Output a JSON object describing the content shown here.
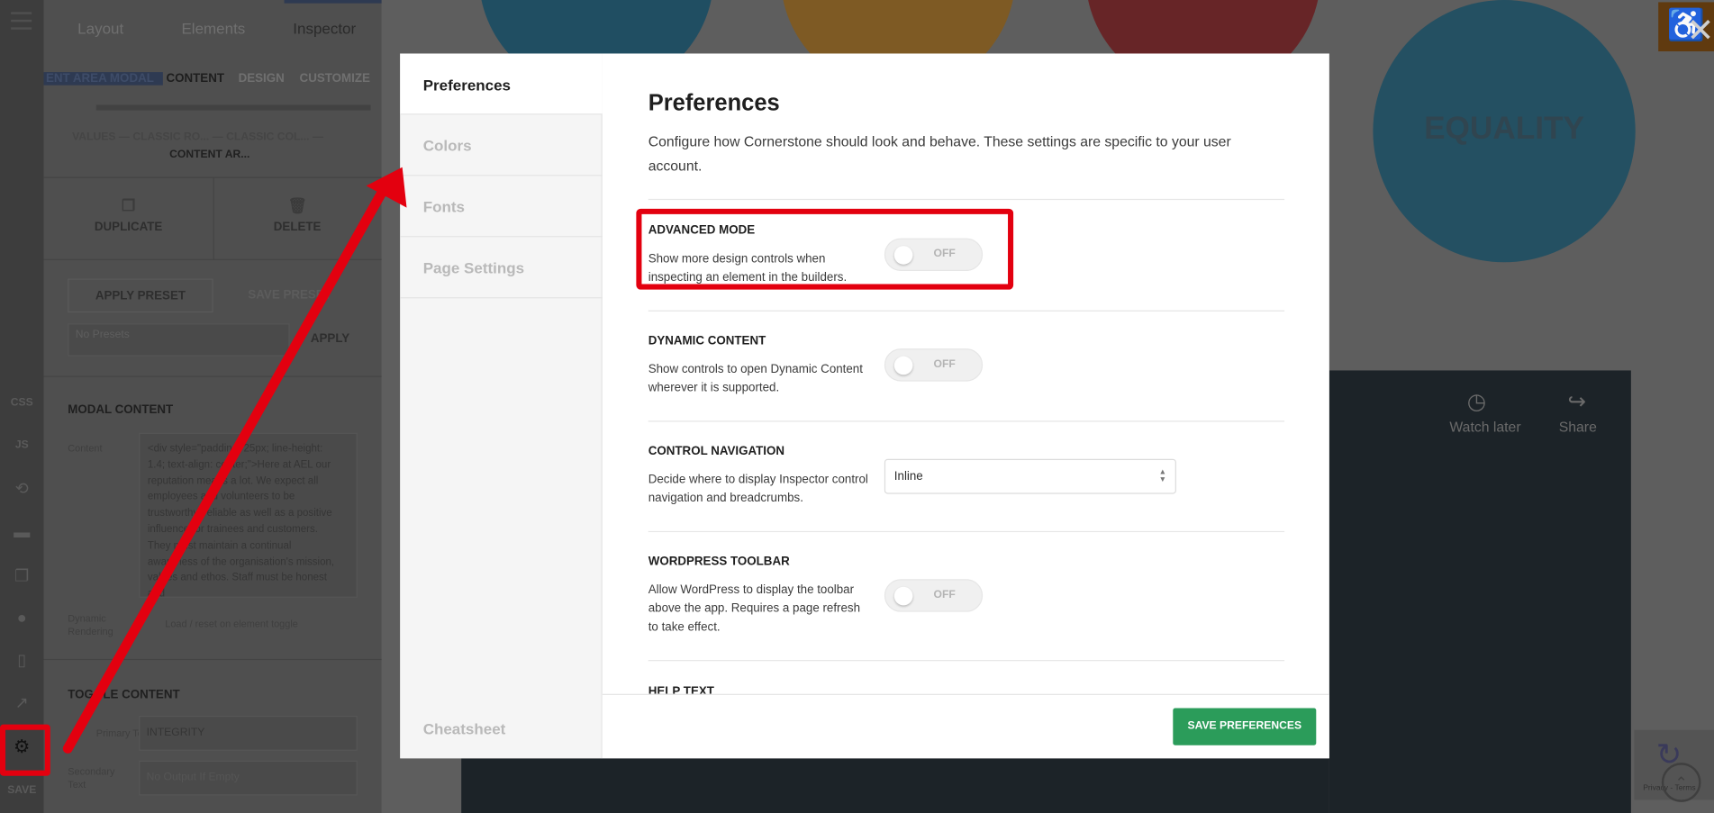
{
  "rail": {
    "css_label": "CSS",
    "js_label": "JS",
    "save_label": "SAVE"
  },
  "panel": {
    "tabs": [
      "Layout",
      "Elements",
      "Inspector"
    ],
    "crumbs": [
      "ENT AREA MODAL",
      "CONTENT",
      "DESIGN",
      "CUSTOMIZE"
    ],
    "breadcrumb_path": "VALUES  —  CLASSIC RO...  —  CLASSIC COL...  —",
    "breadcrumb_current": "CONTENT AR...",
    "duplicate_label": "DUPLICATE",
    "delete_label": "DELETE",
    "apply_preset_label": "APPLY PRESET",
    "save_preset_label": "SAVE PRESET",
    "preset_placeholder": "No Presets",
    "apply_label": "APPLY",
    "modal_content_heading": "MODAL CONTENT",
    "content_label": "Content",
    "content_value": "<div style=\"padding: 25px; line-height: 1.4; text-align: center;\">Here at AEL our reputation means a lot. We expect all employees and volunteers to be trustworthy, reliable as well as a positive influence for trainees and customers. They must maintain a continual awareness of the organisation's mission, values and ethos. Staff must be honest and",
    "dynamic_rendering_label": "Dynamic Rendering",
    "dynamic_rendering_value": "Load / reset on element toggle",
    "toggle_content_heading": "TOGGLE CONTENT",
    "primary_text_label": "Primary Text",
    "primary_text_value": "INTEGRITY",
    "secondary_text_label": "Secondary Text",
    "secondary_text_placeholder": "No Output If Empty"
  },
  "background": {
    "equality_text": "EQUALITY",
    "watch_later": "Watch later",
    "share": "Share",
    "recaptcha_text": "Privacy - Terms"
  },
  "modal": {
    "nav": [
      "Preferences",
      "Colors",
      "Fonts",
      "Page Settings"
    ],
    "cheatsheet": "Cheatsheet",
    "title": "Preferences",
    "description": "Configure how Cornerstone should look and behave. These settings are specific to your user account.",
    "sections": [
      {
        "title": "ADVANCED MODE",
        "desc": "Show more design controls when inspecting an element in the builders.",
        "state": "OFF"
      },
      {
        "title": "DYNAMIC CONTENT",
        "desc": "Show controls to open Dynamic Content wherever it is supported.",
        "state": "OFF"
      },
      {
        "title": "CONTROL NAVIGATION",
        "desc": "Decide where to display Inspector control navigation and breadcrumbs.",
        "value": "Inline"
      },
      {
        "title": "WORDPRESS TOOLBAR",
        "desc": "Allow WordPress to display the toolbar above the app. Requires a page refresh to take effect.",
        "state": "OFF"
      },
      {
        "title": "HELP TEXT"
      }
    ],
    "save_label": "SAVE PREFERENCES"
  },
  "colors": {
    "highlight": "#e3000f",
    "save_button": "#2b9c5a"
  }
}
